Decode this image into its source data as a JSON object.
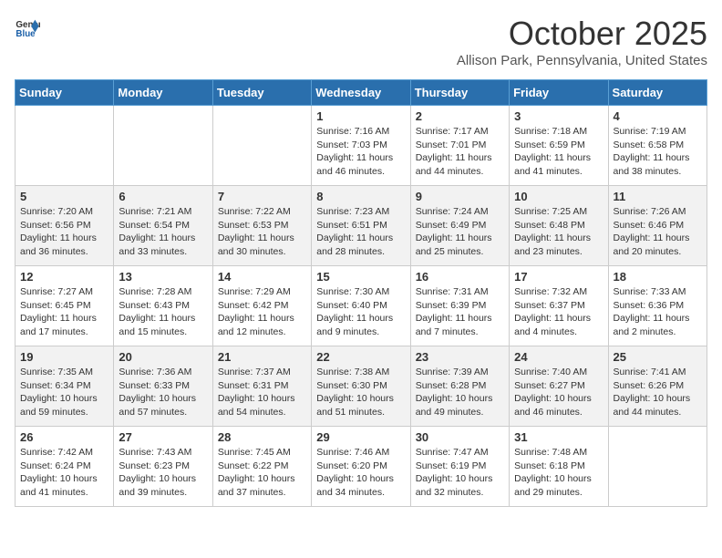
{
  "header": {
    "logo_general": "General",
    "logo_blue": "Blue",
    "month_title": "October 2025",
    "location": "Allison Park, Pennsylvania, United States"
  },
  "days_of_week": [
    "Sunday",
    "Monday",
    "Tuesday",
    "Wednesday",
    "Thursday",
    "Friday",
    "Saturday"
  ],
  "weeks": [
    [
      {
        "day": "",
        "info": ""
      },
      {
        "day": "",
        "info": ""
      },
      {
        "day": "",
        "info": ""
      },
      {
        "day": "1",
        "info": "Sunrise: 7:16 AM\nSunset: 7:03 PM\nDaylight: 11 hours and 46 minutes."
      },
      {
        "day": "2",
        "info": "Sunrise: 7:17 AM\nSunset: 7:01 PM\nDaylight: 11 hours and 44 minutes."
      },
      {
        "day": "3",
        "info": "Sunrise: 7:18 AM\nSunset: 6:59 PM\nDaylight: 11 hours and 41 minutes."
      },
      {
        "day": "4",
        "info": "Sunrise: 7:19 AM\nSunset: 6:58 PM\nDaylight: 11 hours and 38 minutes."
      }
    ],
    [
      {
        "day": "5",
        "info": "Sunrise: 7:20 AM\nSunset: 6:56 PM\nDaylight: 11 hours and 36 minutes."
      },
      {
        "day": "6",
        "info": "Sunrise: 7:21 AM\nSunset: 6:54 PM\nDaylight: 11 hours and 33 minutes."
      },
      {
        "day": "7",
        "info": "Sunrise: 7:22 AM\nSunset: 6:53 PM\nDaylight: 11 hours and 30 minutes."
      },
      {
        "day": "8",
        "info": "Sunrise: 7:23 AM\nSunset: 6:51 PM\nDaylight: 11 hours and 28 minutes."
      },
      {
        "day": "9",
        "info": "Sunrise: 7:24 AM\nSunset: 6:49 PM\nDaylight: 11 hours and 25 minutes."
      },
      {
        "day": "10",
        "info": "Sunrise: 7:25 AM\nSunset: 6:48 PM\nDaylight: 11 hours and 23 minutes."
      },
      {
        "day": "11",
        "info": "Sunrise: 7:26 AM\nSunset: 6:46 PM\nDaylight: 11 hours and 20 minutes."
      }
    ],
    [
      {
        "day": "12",
        "info": "Sunrise: 7:27 AM\nSunset: 6:45 PM\nDaylight: 11 hours and 17 minutes."
      },
      {
        "day": "13",
        "info": "Sunrise: 7:28 AM\nSunset: 6:43 PM\nDaylight: 11 hours and 15 minutes."
      },
      {
        "day": "14",
        "info": "Sunrise: 7:29 AM\nSunset: 6:42 PM\nDaylight: 11 hours and 12 minutes."
      },
      {
        "day": "15",
        "info": "Sunrise: 7:30 AM\nSunset: 6:40 PM\nDaylight: 11 hours and 9 minutes."
      },
      {
        "day": "16",
        "info": "Sunrise: 7:31 AM\nSunset: 6:39 PM\nDaylight: 11 hours and 7 minutes."
      },
      {
        "day": "17",
        "info": "Sunrise: 7:32 AM\nSunset: 6:37 PM\nDaylight: 11 hours and 4 minutes."
      },
      {
        "day": "18",
        "info": "Sunrise: 7:33 AM\nSunset: 6:36 PM\nDaylight: 11 hours and 2 minutes."
      }
    ],
    [
      {
        "day": "19",
        "info": "Sunrise: 7:35 AM\nSunset: 6:34 PM\nDaylight: 10 hours and 59 minutes."
      },
      {
        "day": "20",
        "info": "Sunrise: 7:36 AM\nSunset: 6:33 PM\nDaylight: 10 hours and 57 minutes."
      },
      {
        "day": "21",
        "info": "Sunrise: 7:37 AM\nSunset: 6:31 PM\nDaylight: 10 hours and 54 minutes."
      },
      {
        "day": "22",
        "info": "Sunrise: 7:38 AM\nSunset: 6:30 PM\nDaylight: 10 hours and 51 minutes."
      },
      {
        "day": "23",
        "info": "Sunrise: 7:39 AM\nSunset: 6:28 PM\nDaylight: 10 hours and 49 minutes."
      },
      {
        "day": "24",
        "info": "Sunrise: 7:40 AM\nSunset: 6:27 PM\nDaylight: 10 hours and 46 minutes."
      },
      {
        "day": "25",
        "info": "Sunrise: 7:41 AM\nSunset: 6:26 PM\nDaylight: 10 hours and 44 minutes."
      }
    ],
    [
      {
        "day": "26",
        "info": "Sunrise: 7:42 AM\nSunset: 6:24 PM\nDaylight: 10 hours and 41 minutes."
      },
      {
        "day": "27",
        "info": "Sunrise: 7:43 AM\nSunset: 6:23 PM\nDaylight: 10 hours and 39 minutes."
      },
      {
        "day": "28",
        "info": "Sunrise: 7:45 AM\nSunset: 6:22 PM\nDaylight: 10 hours and 37 minutes."
      },
      {
        "day": "29",
        "info": "Sunrise: 7:46 AM\nSunset: 6:20 PM\nDaylight: 10 hours and 34 minutes."
      },
      {
        "day": "30",
        "info": "Sunrise: 7:47 AM\nSunset: 6:19 PM\nDaylight: 10 hours and 32 minutes."
      },
      {
        "day": "31",
        "info": "Sunrise: 7:48 AM\nSunset: 6:18 PM\nDaylight: 10 hours and 29 minutes."
      },
      {
        "day": "",
        "info": ""
      }
    ]
  ]
}
